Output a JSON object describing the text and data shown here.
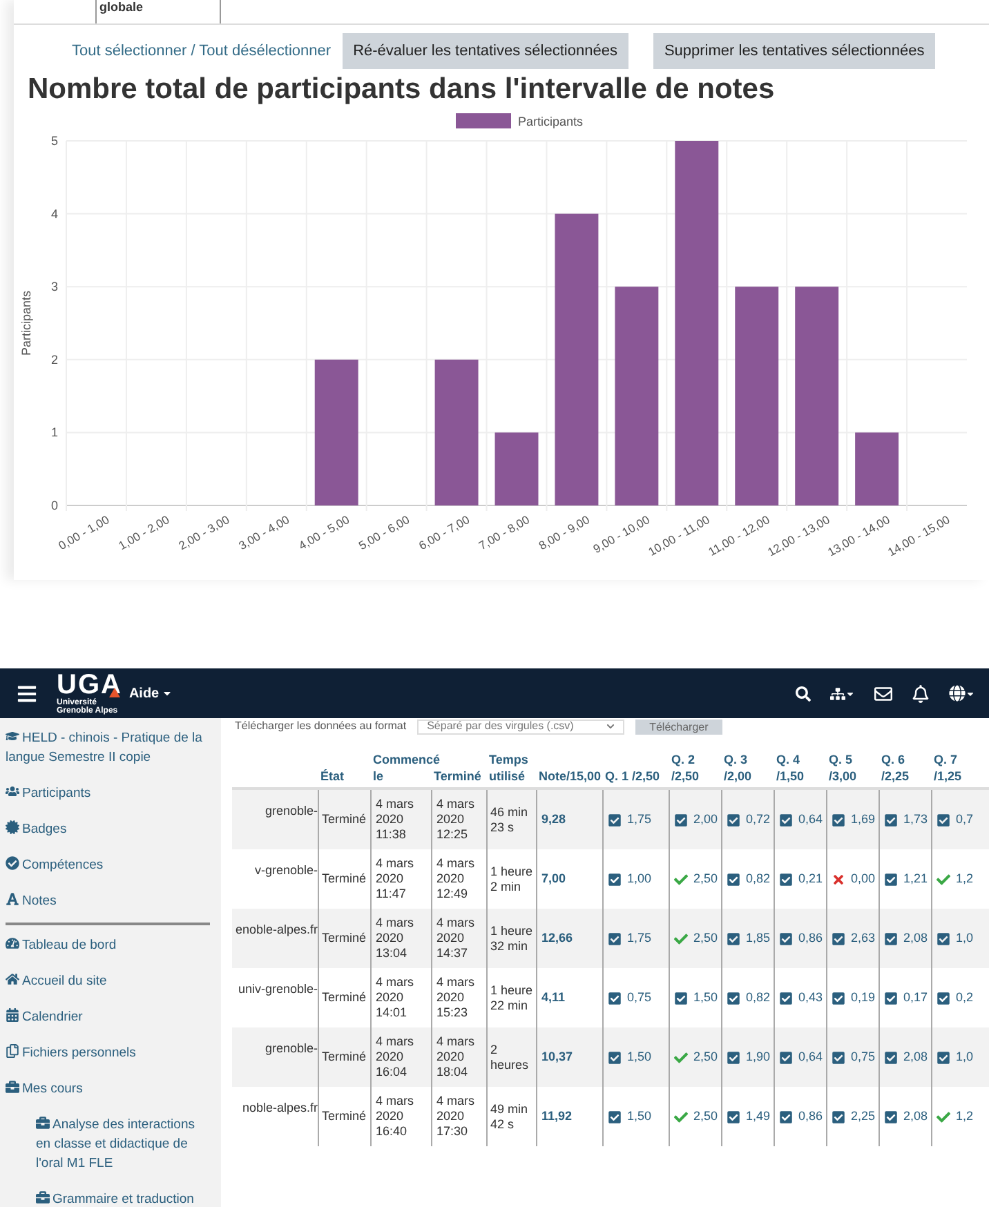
{
  "report": {
    "top_cell": "globale",
    "select_all": "Tout sélectionner",
    "separator": "/",
    "deselect_all": "Tout désélectionner",
    "buttons": [
      "Ré-évaluer les tentatives sélectionnées",
      "Supprimer les tentatives sélectionnées"
    ],
    "title": "Nombre total de participants dans l'intervalle de notes",
    "chart_data": {
      "type": "bar",
      "ylabel": "Participants",
      "categories": [
        "0,00 - 1,00",
        "1,00 - 2,00",
        "2,00 - 3,00",
        "3,00 - 4,00",
        "4,00 - 5,00",
        "5,00 - 6,00",
        "6,00 - 7,00",
        "7,00 - 8,00",
        "8,00 - 9,00",
        "9,00 - 10,00",
        "10,00 - 11,00",
        "11,00 - 12,00",
        "12,00 - 13,00",
        "13,00 - 14,00",
        "14,00 - 15,00"
      ],
      "series": [
        {
          "name": "Participants",
          "color": "#8a5796",
          "values": [
            0,
            0,
            0,
            0,
            2,
            0,
            2,
            1,
            4,
            3,
            5,
            3,
            3,
            1,
            0
          ]
        }
      ],
      "ylim": [
        0,
        5
      ],
      "yticks": [
        0,
        1,
        2,
        3,
        4,
        5
      ],
      "grid": true
    }
  },
  "navbar": {
    "logo": {
      "mark": "UGA",
      "line1": "Université",
      "line2": "Grenoble Alpes"
    },
    "help": "Aide"
  },
  "sidebar": {
    "items": [
      {
        "label": "HELD - chinois - Pratique de la langue Semestre II copie",
        "sub": false,
        "divider": false
      },
      {
        "label": "Participants",
        "sub": false,
        "divider": false
      },
      {
        "label": "Badges",
        "sub": false,
        "divider": false
      },
      {
        "label": "Compétences",
        "sub": false,
        "divider": false
      },
      {
        "label": "Notes",
        "sub": false,
        "divider": true
      },
      {
        "label": "Tableau de bord",
        "sub": false,
        "divider": false
      },
      {
        "label": "Accueil du site",
        "sub": false,
        "divider": false
      },
      {
        "label": "Calendrier",
        "sub": false,
        "divider": false
      },
      {
        "label": "Fichiers personnels",
        "sub": false,
        "divider": false
      },
      {
        "label": "Mes cours",
        "sub": false,
        "divider": false
      },
      {
        "label": "Analyse des interactions en classe et didactique de l'oral M1 FLE",
        "sub": true,
        "divider": false
      },
      {
        "label": "Grammaire et traduction",
        "sub": true,
        "divider": false
      }
    ]
  },
  "download": {
    "label": "Télécharger les données au format",
    "format": "Séparé par des virgules (.csv)",
    "button": "Télécharger"
  },
  "table": {
    "columns": [
      "",
      "État",
      "Commencé le",
      "Terminé",
      "Temps utilisé",
      "Note/15,00",
      "Q. 1 /2,50",
      "Q. 2 /2,50",
      "Q. 3 /2,00",
      "Q. 4 /1,50",
      "Q. 5 /3,00",
      "Q. 6 /2,25",
      "Q. 7 /1,25"
    ],
    "rows": [
      {
        "email": "grenoble-",
        "state": "Terminé",
        "started": "4 mars 2020 11:38",
        "finished": "4 mars 2020 12:25",
        "time": "46 min 23 s",
        "grade": "9,28",
        "q": [
          {
            "kind": "partial",
            "value": "1,75"
          },
          {
            "kind": "partial",
            "value": "2,00"
          },
          {
            "kind": "partial",
            "value": "0,72"
          },
          {
            "kind": "partial",
            "value": "0,64"
          },
          {
            "kind": "partial",
            "value": "1,69"
          },
          {
            "kind": "partial",
            "value": "1,73"
          },
          {
            "kind": "partial",
            "value": "0,7"
          }
        ]
      },
      {
        "email": "v-grenoble-",
        "state": "Terminé",
        "started": "4 mars 2020 11:47",
        "finished": "4 mars 2020 12:49",
        "time": "1 heure 2 min",
        "grade": "7,00",
        "q": [
          {
            "kind": "partial",
            "value": "1,00"
          },
          {
            "kind": "correct",
            "value": "2,50"
          },
          {
            "kind": "partial",
            "value": "0,82"
          },
          {
            "kind": "partial",
            "value": "0,21"
          },
          {
            "kind": "wrong",
            "value": "0,00"
          },
          {
            "kind": "partial",
            "value": "1,21"
          },
          {
            "kind": "correct",
            "value": "1,2"
          }
        ]
      },
      {
        "email": "enoble-alpes.fr",
        "state": "Terminé",
        "started": "4 mars 2020 13:04",
        "finished": "4 mars 2020 14:37",
        "time": "1 heure 32 min",
        "grade": "12,66",
        "q": [
          {
            "kind": "partial",
            "value": "1,75"
          },
          {
            "kind": "correct",
            "value": "2,50"
          },
          {
            "kind": "partial",
            "value": "1,85"
          },
          {
            "kind": "partial",
            "value": "0,86"
          },
          {
            "kind": "partial",
            "value": "2,63"
          },
          {
            "kind": "partial",
            "value": "2,08"
          },
          {
            "kind": "partial",
            "value": "1,0"
          }
        ]
      },
      {
        "email": "univ-grenoble-",
        "state": "Terminé",
        "started": "4 mars 2020 14:01",
        "finished": "4 mars 2020 15:23",
        "time": "1 heure 22 min",
        "grade": "4,11",
        "q": [
          {
            "kind": "partial",
            "value": "0,75"
          },
          {
            "kind": "partial",
            "value": "1,50"
          },
          {
            "kind": "partial",
            "value": "0,82"
          },
          {
            "kind": "partial",
            "value": "0,43"
          },
          {
            "kind": "partial",
            "value": "0,19"
          },
          {
            "kind": "partial",
            "value": "0,17"
          },
          {
            "kind": "partial",
            "value": "0,2"
          }
        ]
      },
      {
        "email": "grenoble-",
        "state": "Terminé",
        "started": "4 mars 2020 16:04",
        "finished": "4 mars 2020 18:04",
        "time": "2 heures",
        "grade": "10,37",
        "q": [
          {
            "kind": "partial",
            "value": "1,50"
          },
          {
            "kind": "correct",
            "value": "2,50"
          },
          {
            "kind": "partial",
            "value": "1,90"
          },
          {
            "kind": "partial",
            "value": "0,64"
          },
          {
            "kind": "partial",
            "value": "0,75"
          },
          {
            "kind": "partial",
            "value": "2,08"
          },
          {
            "kind": "partial",
            "value": "1,0"
          }
        ]
      },
      {
        "email": "noble-alpes.fr",
        "state": "Terminé",
        "started": "4 mars 2020 16:40",
        "finished": "4 mars 2020 17:30",
        "time": "49 min 42 s",
        "grade": "11,92",
        "q": [
          {
            "kind": "partial",
            "value": "1,50"
          },
          {
            "kind": "correct",
            "value": "2,50"
          },
          {
            "kind": "partial",
            "value": "1,49"
          },
          {
            "kind": "partial",
            "value": "0,86"
          },
          {
            "kind": "partial",
            "value": "2,25"
          },
          {
            "kind": "partial",
            "value": "2,08"
          },
          {
            "kind": "correct",
            "value": "1,2"
          }
        ]
      }
    ]
  }
}
